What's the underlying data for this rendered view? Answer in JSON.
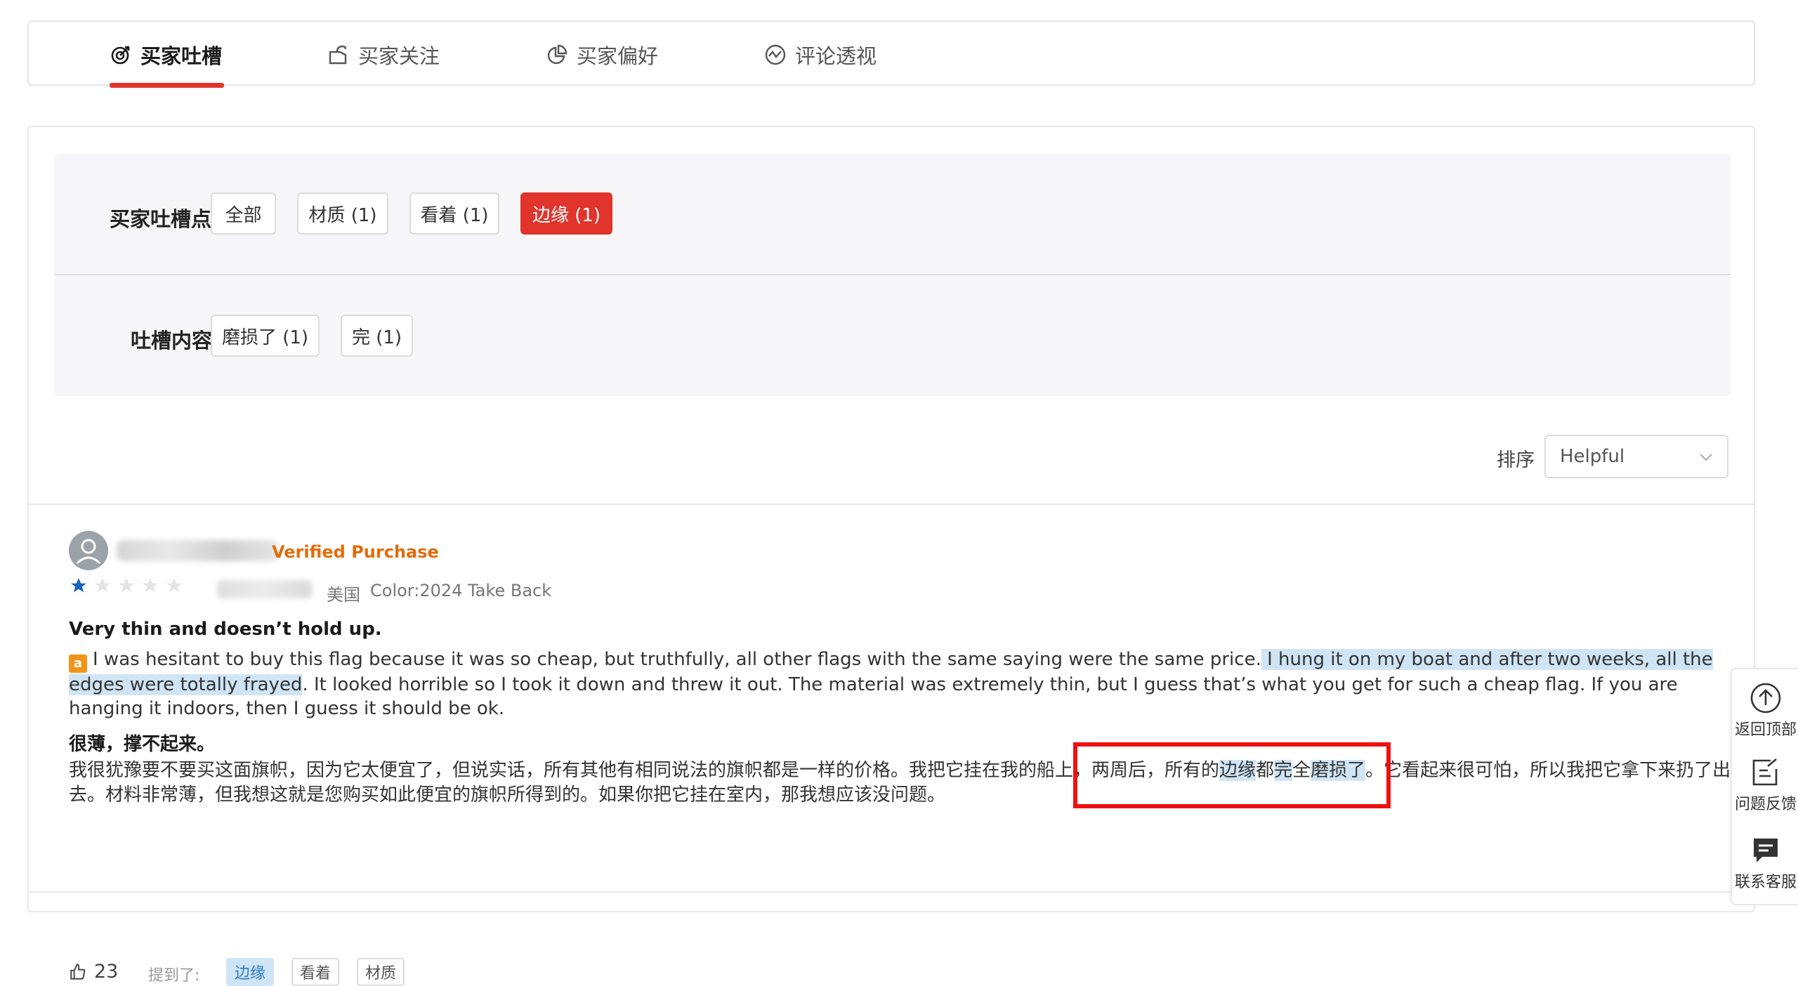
{
  "tabs": [
    {
      "label": "买家吐槽",
      "icon": "target-icon"
    },
    {
      "label": "买家关注",
      "icon": "tag-cube-icon"
    },
    {
      "label": "买家偏好",
      "icon": "pie-chart-icon"
    },
    {
      "label": "评论透视",
      "icon": "trend-circle-icon"
    }
  ],
  "filters": {
    "complaint_points_label": "买家吐槽点",
    "complaint_points": [
      "全部",
      "材质 (1)",
      "看着 (1)",
      "边缘 (1)"
    ],
    "complaint_content_label": "吐槽内容",
    "complaint_content": [
      "磨损了 (1)",
      "完 (1)"
    ]
  },
  "sort": {
    "label": "排序",
    "value": "Helpful"
  },
  "review": {
    "verified": "Verified Purchase",
    "rating": 1,
    "country": "美国",
    "color": "Color:2024 Take Back",
    "title": "Very thin and doesn’t hold up.",
    "amazon_badge": "a",
    "body_part1": "I was hesitant to buy this flag because it was so cheap, but truthfully, all other flags with the same saying were the same price.",
    "body_highlight": " I hung it on my boat and after two weeks, all the edges were totally frayed",
    "body_part2": ". It looked horrible so I took it down and threw it out. The material was extremely thin, but I guess that’s what you get for such a cheap flag. If you are hanging it indoors, then I guess it should be ok.",
    "title_cn": "很薄，撑不起来。",
    "body_cn_1": "我很犹豫要不要买这面旗帜，因为它太便宜了，但说实话，所有其他有相同说法的旗帜都是一样的价格。我把它挂在我的船上，两周后，所有的",
    "body_cn_hl1": "边缘",
    "body_cn_2": "都",
    "body_cn_hl2": "完",
    "body_cn_3": "全",
    "body_cn_hl3": "磨损了",
    "body_cn_4": "。它看起来很可怕，所以我把它拿下来扔了出去。材料非常薄，但我想这就是您购买如此便宜的旗帜所得到的。如果你把它挂在室内，那我想应该没问题。",
    "likes": "23",
    "mentioned_label": "提到了:",
    "mentioned_tags": [
      "边缘",
      "看着",
      "材质"
    ]
  },
  "float_panel": [
    {
      "label": "返回顶部",
      "icon": "arrow-up-circle-icon"
    },
    {
      "label": "问题反馈",
      "icon": "feedback-edit-icon"
    },
    {
      "label": "联系客服",
      "icon": "chat-bubble-icon"
    }
  ],
  "colors": {
    "accent": "#e0342c",
    "highlight": "#cfe5f5",
    "verified": "#e36c0a",
    "star": "#1565c0"
  }
}
